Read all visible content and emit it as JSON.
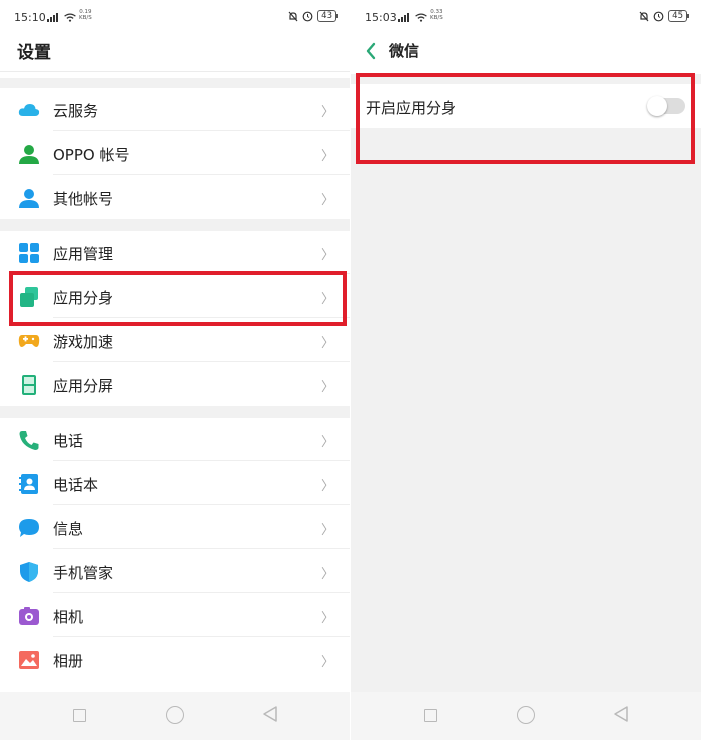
{
  "left": {
    "status": {
      "time": "15:10",
      "speed_top": "0.19",
      "speed_bottom": "KB/S",
      "battery": "43"
    },
    "title": "设置",
    "groups": [
      {
        "items": [
          {
            "label": "云服务"
          },
          {
            "label": "OPPO 帐号"
          },
          {
            "label": "其他帐号"
          }
        ]
      },
      {
        "items": [
          {
            "label": "应用管理"
          },
          {
            "label": "应用分身"
          },
          {
            "label": "游戏加速"
          },
          {
            "label": "应用分屏"
          }
        ]
      },
      {
        "items": [
          {
            "label": "电话"
          },
          {
            "label": "电话本"
          },
          {
            "label": "信息"
          },
          {
            "label": "手机管家"
          },
          {
            "label": "相机"
          },
          {
            "label": "相册"
          }
        ]
      }
    ],
    "chevron": "〉"
  },
  "right": {
    "status": {
      "time": "15:03",
      "speed_top": "0.33",
      "speed_bottom": "KB/S",
      "battery": "45"
    },
    "title": "微信",
    "toggle": {
      "label": "开启应用分身",
      "on": false
    }
  },
  "colors": {
    "highlight": "#e01e2b",
    "accent_back": "#2aa876",
    "toggle_off": "#dddddd"
  }
}
